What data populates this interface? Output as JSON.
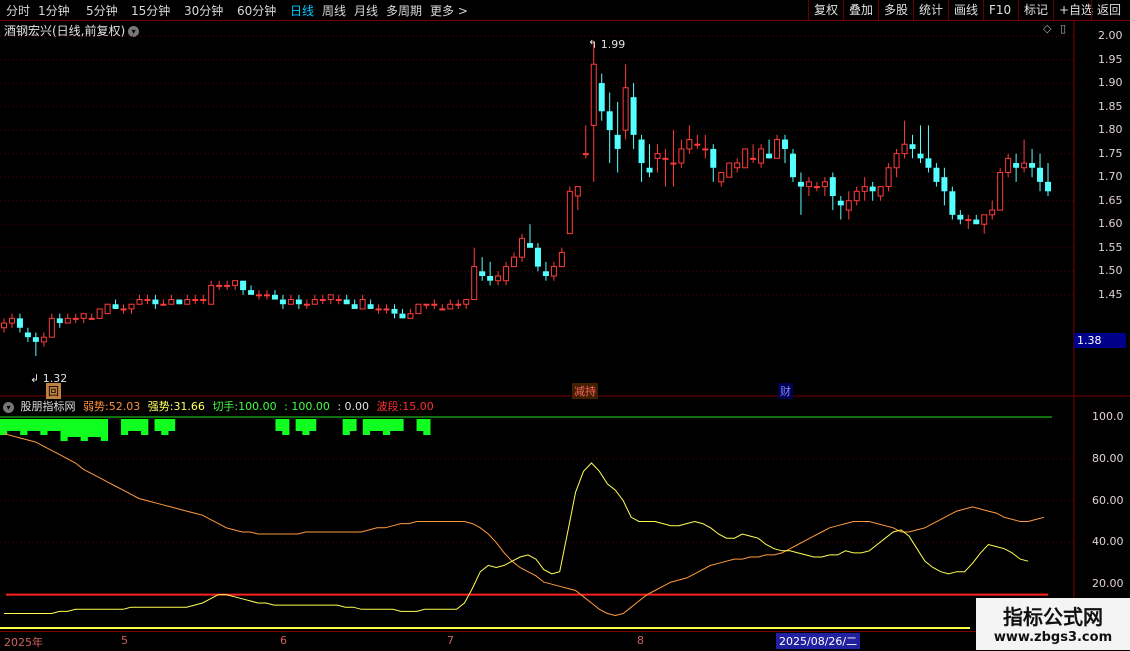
{
  "toolbar": {
    "timeframes": [
      "分时",
      "1分钟",
      "5分钟",
      "15分钟",
      "30分钟",
      "60分钟",
      "日线",
      "周线",
      "月线",
      "多周期",
      "更多 >"
    ],
    "active": "日线",
    "right_buttons": [
      "复权",
      "叠加",
      "多股",
      "统计",
      "画线",
      "F10",
      "标记",
      "+自选",
      "返回"
    ]
  },
  "stock": {
    "title": "酒钢宏兴(日线,前复权)"
  },
  "price_axis": {
    "ticks": [
      "2.00",
      "1.95",
      "1.90",
      "1.85",
      "1.80",
      "1.75",
      "1.70",
      "1.65",
      "1.60",
      "1.55",
      "1.50",
      "1.45"
    ],
    "last_price": "1.38"
  },
  "annotations": {
    "high": "1.99",
    "low": "1.32",
    "event1": "回",
    "event2": "减持",
    "event3": "财"
  },
  "indicator": {
    "name": "股朋指标网",
    "weak_label": "弱势:",
    "weak_value": "52.03",
    "strong_label": "强势:",
    "strong_value": "31.66",
    "switch_label": "切手:",
    "switch_value": "100.00",
    "v4": ": 100.00",
    "v5": ": 0.00",
    "wave_label": "波段:",
    "wave_value": "15.00",
    "ticks": [
      "100.0",
      "80.00",
      "60.00",
      "40.00",
      "20.00"
    ]
  },
  "dates": {
    "labels": [
      "2025年",
      "5",
      "6",
      "7",
      "8"
    ],
    "selected": "2025/08/26/二"
  },
  "watermark": {
    "line1": "指标公式网",
    "line2": "www.zbgs3.com"
  },
  "chart_data": {
    "type": "candlestick",
    "price_range": [
      1.3,
      2.02
    ],
    "candles": [
      [
        1.38,
        1.4,
        1.37,
        1.39
      ],
      [
        1.39,
        1.41,
        1.38,
        1.4
      ],
      [
        1.4,
        1.41,
        1.37,
        1.38
      ],
      [
        1.37,
        1.38,
        1.35,
        1.36
      ],
      [
        1.36,
        1.37,
        1.32,
        1.35
      ],
      [
        1.35,
        1.37,
        1.34,
        1.36
      ],
      [
        1.36,
        1.41,
        1.36,
        1.4
      ],
      [
        1.4,
        1.41,
        1.38,
        1.39
      ],
      [
        1.39,
        1.41,
        1.39,
        1.4
      ],
      [
        1.4,
        1.41,
        1.39,
        1.4
      ],
      [
        1.4,
        1.41,
        1.39,
        1.41
      ],
      [
        1.4,
        1.41,
        1.4,
        1.4
      ],
      [
        1.4,
        1.42,
        1.4,
        1.42
      ],
      [
        1.41,
        1.43,
        1.41,
        1.43
      ],
      [
        1.43,
        1.44,
        1.42,
        1.42
      ],
      [
        1.42,
        1.43,
        1.41,
        1.42
      ],
      [
        1.42,
        1.43,
        1.41,
        1.43
      ],
      [
        1.43,
        1.45,
        1.43,
        1.44
      ],
      [
        1.44,
        1.45,
        1.43,
        1.44
      ],
      [
        1.44,
        1.45,
        1.42,
        1.43
      ],
      [
        1.43,
        1.44,
        1.43,
        1.43
      ],
      [
        1.43,
        1.45,
        1.43,
        1.44
      ],
      [
        1.44,
        1.44,
        1.43,
        1.43
      ],
      [
        1.43,
        1.45,
        1.43,
        1.44
      ],
      [
        1.44,
        1.45,
        1.43,
        1.44
      ],
      [
        1.44,
        1.45,
        1.43,
        1.44
      ],
      [
        1.43,
        1.48,
        1.43,
        1.47
      ],
      [
        1.47,
        1.48,
        1.46,
        1.47
      ],
      [
        1.47,
        1.48,
        1.46,
        1.47
      ],
      [
        1.47,
        1.48,
        1.46,
        1.48
      ],
      [
        1.48,
        1.48,
        1.45,
        1.46
      ],
      [
        1.46,
        1.47,
        1.45,
        1.45
      ],
      [
        1.45,
        1.46,
        1.44,
        1.45
      ],
      [
        1.45,
        1.46,
        1.44,
        1.45
      ],
      [
        1.45,
        1.46,
        1.44,
        1.44
      ],
      [
        1.44,
        1.45,
        1.42,
        1.43
      ],
      [
        1.43,
        1.45,
        1.43,
        1.44
      ],
      [
        1.44,
        1.45,
        1.42,
        1.43
      ],
      [
        1.43,
        1.44,
        1.42,
        1.43
      ],
      [
        1.43,
        1.45,
        1.43,
        1.44
      ],
      [
        1.44,
        1.45,
        1.43,
        1.44
      ],
      [
        1.44,
        1.45,
        1.43,
        1.45
      ],
      [
        1.44,
        1.45,
        1.43,
        1.44
      ],
      [
        1.44,
        1.45,
        1.43,
        1.43
      ],
      [
        1.43,
        1.44,
        1.42,
        1.42
      ],
      [
        1.42,
        1.45,
        1.42,
        1.44
      ],
      [
        1.43,
        1.44,
        1.42,
        1.42
      ],
      [
        1.42,
        1.43,
        1.41,
        1.42
      ],
      [
        1.42,
        1.43,
        1.41,
        1.42
      ],
      [
        1.42,
        1.43,
        1.4,
        1.41
      ],
      [
        1.41,
        1.42,
        1.4,
        1.4
      ],
      [
        1.4,
        1.42,
        1.4,
        1.41
      ],
      [
        1.41,
        1.43,
        1.41,
        1.43
      ],
      [
        1.43,
        1.43,
        1.42,
        1.43
      ],
      [
        1.43,
        1.44,
        1.42,
        1.43
      ],
      [
        1.42,
        1.43,
        1.42,
        1.42
      ],
      [
        1.42,
        1.44,
        1.42,
        1.43
      ],
      [
        1.43,
        1.44,
        1.42,
        1.43
      ],
      [
        1.43,
        1.44,
        1.42,
        1.44
      ],
      [
        1.44,
        1.55,
        1.44,
        1.51
      ],
      [
        1.5,
        1.53,
        1.48,
        1.49
      ],
      [
        1.49,
        1.52,
        1.47,
        1.48
      ],
      [
        1.48,
        1.5,
        1.47,
        1.49
      ],
      [
        1.48,
        1.52,
        1.47,
        1.51
      ],
      [
        1.51,
        1.54,
        1.51,
        1.53
      ],
      [
        1.53,
        1.58,
        1.52,
        1.57
      ],
      [
        1.56,
        1.6,
        1.55,
        1.55
      ],
      [
        1.55,
        1.56,
        1.5,
        1.51
      ],
      [
        1.5,
        1.52,
        1.48,
        1.49
      ],
      [
        1.49,
        1.52,
        1.48,
        1.51
      ],
      [
        1.51,
        1.55,
        1.51,
        1.54
      ],
      [
        1.58,
        1.68,
        1.58,
        1.67
      ],
      [
        1.66,
        1.68,
        1.63,
        1.68
      ],
      [
        1.75,
        1.81,
        1.74,
        1.75
      ],
      [
        1.81,
        1.99,
        1.69,
        1.94
      ],
      [
        1.9,
        1.92,
        1.82,
        1.84
      ],
      [
        1.84,
        1.88,
        1.73,
        1.8
      ],
      [
        1.79,
        1.86,
        1.71,
        1.76
      ],
      [
        1.8,
        1.94,
        1.78,
        1.89
      ],
      [
        1.87,
        1.9,
        1.76,
        1.79
      ],
      [
        1.78,
        1.79,
        1.69,
        1.73
      ],
      [
        1.72,
        1.77,
        1.7,
        1.71
      ],
      [
        1.74,
        1.77,
        1.71,
        1.75
      ],
      [
        1.74,
        1.76,
        1.68,
        1.74
      ],
      [
        1.73,
        1.8,
        1.68,
        1.73
      ],
      [
        1.73,
        1.78,
        1.72,
        1.76
      ],
      [
        1.76,
        1.81,
        1.75,
        1.78
      ],
      [
        1.77,
        1.79,
        1.76,
        1.77
      ],
      [
        1.76,
        1.79,
        1.74,
        1.76
      ],
      [
        1.76,
        1.77,
        1.69,
        1.72
      ],
      [
        1.69,
        1.71,
        1.68,
        1.71
      ],
      [
        1.7,
        1.73,
        1.7,
        1.73
      ],
      [
        1.72,
        1.74,
        1.71,
        1.73
      ],
      [
        1.72,
        1.76,
        1.72,
        1.76
      ],
      [
        1.74,
        1.77,
        1.73,
        1.74
      ],
      [
        1.73,
        1.77,
        1.72,
        1.76
      ],
      [
        1.75,
        1.78,
        1.74,
        1.74
      ],
      [
        1.74,
        1.79,
        1.74,
        1.78
      ],
      [
        1.78,
        1.79,
        1.73,
        1.76
      ],
      [
        1.75,
        1.76,
        1.69,
        1.7
      ],
      [
        1.69,
        1.71,
        1.62,
        1.68
      ],
      [
        1.68,
        1.7,
        1.66,
        1.69
      ],
      [
        1.68,
        1.69,
        1.67,
        1.68
      ],
      [
        1.68,
        1.7,
        1.66,
        1.69
      ],
      [
        1.7,
        1.71,
        1.63,
        1.66
      ],
      [
        1.65,
        1.66,
        1.61,
        1.64
      ],
      [
        1.63,
        1.67,
        1.61,
        1.65
      ],
      [
        1.65,
        1.68,
        1.64,
        1.67
      ],
      [
        1.67,
        1.7,
        1.65,
        1.68
      ],
      [
        1.68,
        1.69,
        1.65,
        1.67
      ],
      [
        1.66,
        1.68,
        1.65,
        1.68
      ],
      [
        1.68,
        1.73,
        1.67,
        1.72
      ],
      [
        1.72,
        1.76,
        1.7,
        1.75
      ],
      [
        1.75,
        1.82,
        1.74,
        1.77
      ],
      [
        1.77,
        1.79,
        1.74,
        1.76
      ],
      [
        1.75,
        1.81,
        1.73,
        1.74
      ],
      [
        1.74,
        1.81,
        1.71,
        1.72
      ],
      [
        1.72,
        1.73,
        1.68,
        1.69
      ],
      [
        1.7,
        1.72,
        1.64,
        1.67
      ],
      [
        1.67,
        1.68,
        1.61,
        1.62
      ],
      [
        1.62,
        1.63,
        1.6,
        1.61
      ],
      [
        1.61,
        1.62,
        1.59,
        1.61
      ],
      [
        1.61,
        1.62,
        1.6,
        1.6
      ],
      [
        1.6,
        1.62,
        1.58,
        1.62
      ],
      [
        1.62,
        1.65,
        1.61,
        1.63
      ],
      [
        1.63,
        1.72,
        1.63,
        1.71
      ],
      [
        1.71,
        1.75,
        1.7,
        1.74
      ],
      [
        1.73,
        1.75,
        1.69,
        1.72
      ],
      [
        1.72,
        1.78,
        1.71,
        1.73
      ],
      [
        1.73,
        1.76,
        1.7,
        1.72
      ],
      [
        1.72,
        1.75,
        1.67,
        1.69
      ],
      [
        1.69,
        1.73,
        1.66,
        1.67
      ]
    ],
    "indicator_series": {
      "orange": [
        92,
        91,
        90,
        89,
        88,
        86,
        84,
        82,
        80,
        78,
        75,
        73,
        71,
        69,
        67,
        65,
        63,
        61,
        60,
        59,
        58,
        57,
        56,
        55,
        54,
        53,
        51,
        49,
        47,
        46,
        45,
        45,
        44,
        44,
        44,
        44,
        44,
        44,
        45,
        45,
        45,
        45,
        45,
        45,
        45,
        45,
        46,
        47,
        47,
        48,
        49,
        49,
        50,
        50,
        50,
        50,
        50,
        50,
        50,
        49,
        47,
        44,
        40,
        35,
        31,
        28,
        26,
        24,
        21,
        20,
        19,
        18,
        17,
        14,
        11,
        8,
        6,
        5,
        6,
        9,
        12,
        15,
        17,
        19,
        21,
        22,
        23,
        25,
        27,
        29,
        30,
        31,
        32,
        32,
        33,
        33,
        34,
        34,
        35,
        37,
        39,
        41,
        43,
        45,
        47,
        48,
        49,
        50,
        50,
        50,
        49,
        48,
        47,
        45,
        45,
        46,
        47,
        49,
        51,
        53,
        55,
        56,
        57,
        56,
        55,
        54,
        52,
        51,
        50,
        50,
        51,
        52
      ],
      "yellow": [
        6,
        6,
        6,
        6,
        6,
        6,
        6,
        7,
        7,
        8,
        8,
        8,
        8,
        8,
        8,
        8,
        9,
        9,
        9,
        9,
        9,
        9,
        9,
        9,
        10,
        11,
        13,
        15,
        15,
        14,
        13,
        12,
        11,
        11,
        10,
        10,
        10,
        10,
        10,
        10,
        10,
        10,
        10,
        9,
        9,
        8,
        8,
        8,
        8,
        8,
        7,
        7,
        7,
        8,
        8,
        8,
        8,
        8,
        11,
        18,
        26,
        29,
        28,
        29,
        31,
        33,
        34,
        32,
        27,
        25,
        26,
        45,
        64,
        74,
        78,
        74,
        68,
        65,
        60,
        52,
        50,
        50,
        50,
        49,
        48,
        48,
        49,
        50,
        49,
        47,
        44,
        42,
        42,
        44,
        43,
        42,
        39,
        37,
        36,
        36,
        35,
        34,
        33,
        33,
        34,
        34,
        36,
        35,
        35,
        36,
        39,
        42,
        45,
        46,
        43,
        37,
        31,
        28,
        26,
        25,
        26,
        26,
        30,
        35,
        39,
        38,
        37,
        35,
        32,
        31
      ]
    },
    "top_bars": [
      1,
      1,
      1,
      1,
      1,
      1,
      1,
      1,
      1,
      1,
      1,
      1,
      1,
      1,
      1,
      1,
      0,
      0,
      1,
      1,
      1,
      1,
      0,
      1,
      1,
      1,
      0,
      0,
      0,
      0,
      0,
      0,
      0,
      0,
      0,
      0,
      0,
      0,
      0,
      0,
      0,
      1,
      1,
      0,
      1,
      1,
      1,
      0,
      0,
      0,
      0,
      1,
      1,
      0,
      1,
      1,
      1,
      1,
      1,
      1,
      0,
      0,
      1,
      1
    ]
  }
}
